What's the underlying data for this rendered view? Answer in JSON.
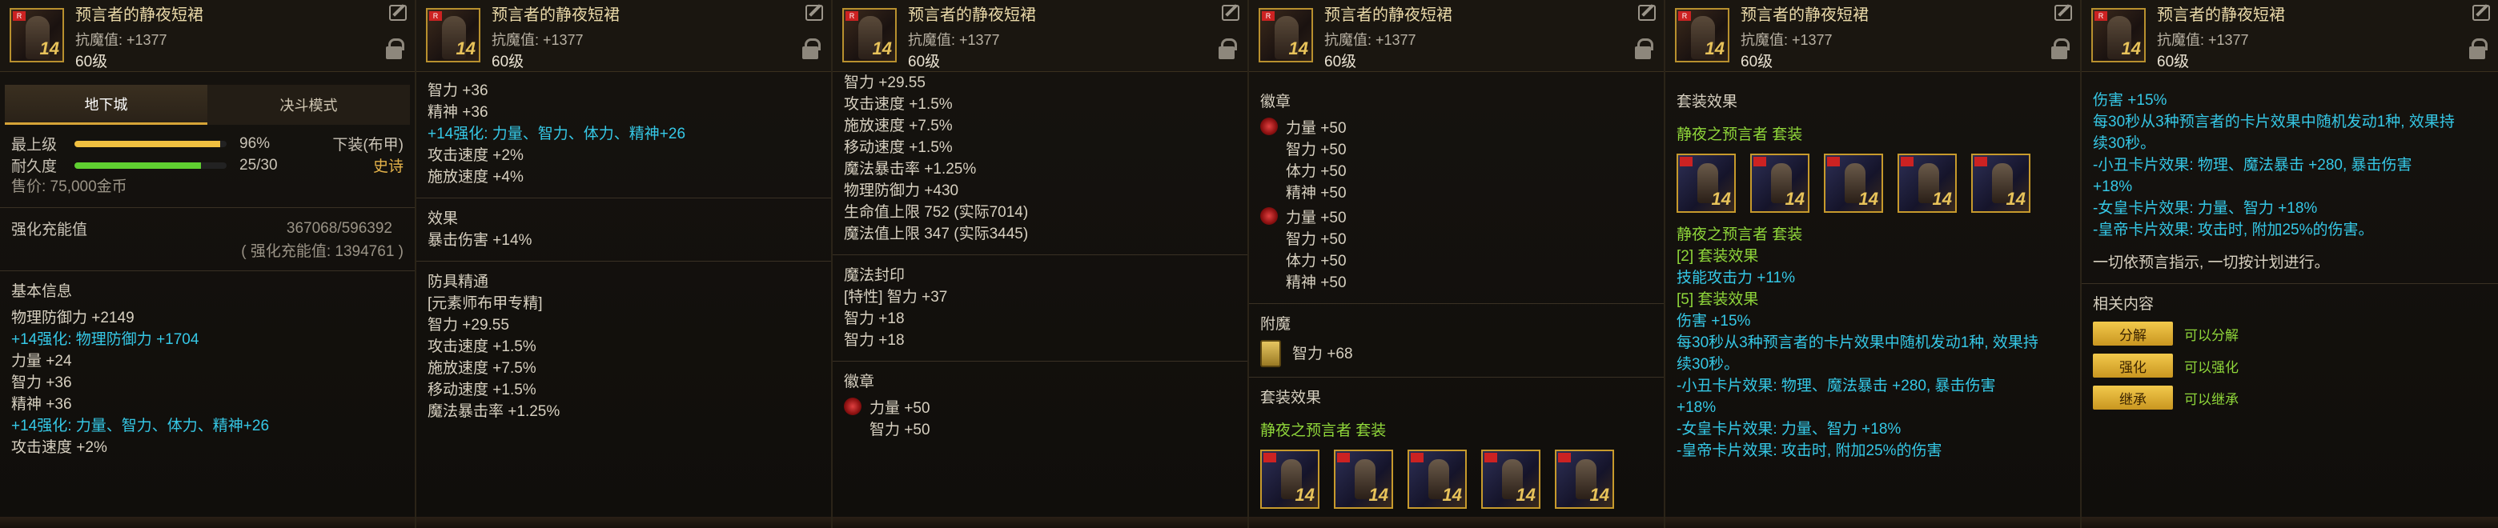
{
  "item": {
    "name": "预言者的静夜短裙",
    "resist": "抗魔值: +1377",
    "level": "60级",
    "icon_tag": "R",
    "icon_rank": "14"
  },
  "icons": {
    "edit": "edit-icon",
    "lock": "lock-icon",
    "seal": "seal-orb-icon",
    "badge": "badge-icon"
  },
  "colors": {
    "gold": "#e3b24a",
    "cyan": "#35c8e6",
    "green": "#8fd63a",
    "bar_gold": "#f0c040",
    "bar_green": "#5fcf30"
  },
  "p1": {
    "tabs": [
      "地下城",
      "决斗模式"
    ],
    "grade_label": "最上级",
    "grade_value": 96,
    "grade_pct": "96%",
    "durability_label": "耐久度",
    "durability_value": 0.8333,
    "durability_text": "25/30",
    "equip_type": "下装(布甲)",
    "rarity": "史诗",
    "price": "售价: 75,000金币",
    "amp_label": "强化充能值",
    "amp_value": "367068/596392",
    "amp_sub": "( 强化充能值: 1394761 )",
    "basic_title": "基本信息",
    "lines": [
      {
        "t": "物理防御力 +2149",
        "c": ""
      },
      {
        "t": "+14强化: 物理防御力 +1704",
        "c": "cyan"
      },
      {
        "t": "力量 +24",
        "c": ""
      },
      {
        "t": "智力 +36",
        "c": ""
      },
      {
        "t": "精神 +36",
        "c": ""
      },
      {
        "t": "+14强化: 力量、智力、体力、精神+26",
        "c": "cyan"
      },
      {
        "t": "攻击速度 +2%",
        "c": ""
      }
    ]
  },
  "p2": {
    "lines_top": [
      {
        "t": "智力 +36",
        "c": ""
      },
      {
        "t": "精神 +36",
        "c": ""
      },
      {
        "t": "+14强化: 力量、智力、体力、精神+26",
        "c": "cyan"
      },
      {
        "t": "攻击速度 +2%",
        "c": ""
      },
      {
        "t": "施放速度 +4%",
        "c": ""
      }
    ],
    "effect_title": "效果",
    "effect_line": "暴击伤害 +14%",
    "mastery_title": "防具精通",
    "mastery_sub": "[元素师布甲专精]",
    "mastery_lines": [
      "智力 +29.55",
      "攻击速度 +1.5%",
      "施放速度 +7.5%",
      "移动速度 +1.5%",
      "魔法暴击率 +1.25%"
    ]
  },
  "p3": {
    "lines_top": [
      "智力 +29.55",
      "攻击速度 +1.5%",
      "施放速度 +7.5%",
      "移动速度 +1.5%",
      "魔法暴击率 +1.25%",
      "物理防御力 +430",
      "生命值上限 752 (实际7014)",
      "魔法值上限 347 (实际3445)"
    ],
    "seal_title": "魔法封印",
    "seal_trait": "[特性] 智力 +37",
    "seal_lines": [
      "智力 +18",
      "智力 +18"
    ],
    "badge_title": "徽章",
    "badge_lines": [
      "力量 +50",
      "智力 +50"
    ]
  },
  "p4": {
    "badge_title": "徽章",
    "badge1": [
      "力量 +50",
      "智力 +50",
      "体力 +50",
      "精神 +50"
    ],
    "badge2": [
      "力量 +50",
      "智力 +50",
      "体力 +50",
      "精神 +50"
    ],
    "enchant_title": "附魔",
    "enchant_line": "智力 +68",
    "set_title": "套装效果",
    "set_name": "静夜之预言者 套装"
  },
  "p5": {
    "set_title": "套装效果",
    "set_name": "静夜之预言者 套装",
    "set_name2": "静夜之预言者 套装",
    "set2_label": "[2] 套装效果",
    "set2_line": "技能攻击力 +11%",
    "set5_label": "[5] 套装效果",
    "set5_lines": [
      "伤害 +15%",
      "每30秒从3种预言者的卡片效果中随机发动1种, 效果持",
      "续30秒。",
      "-小丑卡片效果: 物理、魔法暴击 +280, 暴击伤害",
      "+18%",
      "-女皇卡片效果: 力量、智力 +18%",
      "-皇帝卡片效果: 攻击时, 附加25%的伤害"
    ]
  },
  "p6": {
    "lines": [
      "伤害 +15%",
      "每30秒从3种预言者的卡片效果中随机发动1种, 效果持",
      "续30秒。",
      "-小丑卡片效果: 物理、魔法暴击 +280, 暴击伤害",
      "+18%",
      "-女皇卡片效果: 力量、智力 +18%",
      "-皇帝卡片效果: 攻击时, 附加25%的伤害。"
    ],
    "quote": "一切依预言指示, 一切按计划进行。",
    "related_title": "相关内容",
    "buttons": [
      {
        "b": "分解",
        "l": "可以分解"
      },
      {
        "b": "强化",
        "l": "可以强化"
      },
      {
        "b": "继承",
        "l": "可以继承"
      }
    ]
  }
}
